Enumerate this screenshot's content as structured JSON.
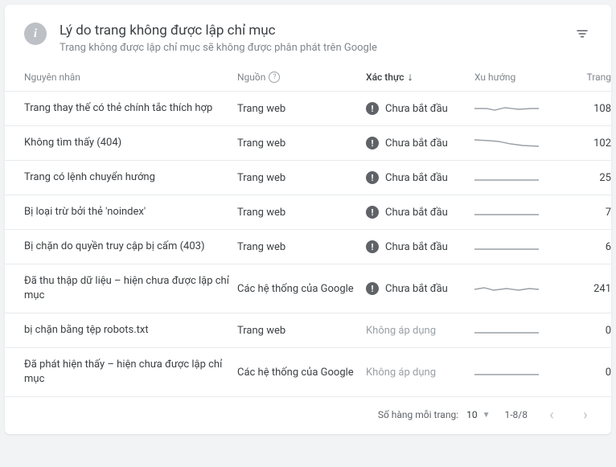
{
  "header": {
    "title": "Lý do trang không được lập chỉ mục",
    "subtitle": "Trang không được lập chỉ mục sẽ không được phân phát trên Google"
  },
  "columns": {
    "reason": "Nguyên nhân",
    "source": "Nguồn",
    "validation": "Xác thực",
    "trend": "Xu hướng",
    "pages": "Trang"
  },
  "status_labels": {
    "not_started": "Chưa bắt đầu",
    "na": "Không áp dụng"
  },
  "rows": [
    {
      "reason": "Trang thay thế có thẻ chính tắc thích hợp",
      "source": "Trang web",
      "status": "not_started",
      "trend": "wobble1",
      "pages": 108
    },
    {
      "reason": "Không tìm thấy (404)",
      "source": "Trang web",
      "status": "not_started",
      "trend": "down1",
      "pages": 102
    },
    {
      "reason": "Trang có lệnh chuyển hướng",
      "source": "Trang web",
      "status": "not_started",
      "trend": "flat",
      "pages": 25
    },
    {
      "reason": "Bị loại trừ bởi thẻ 'noindex'",
      "source": "Trang web",
      "status": "not_started",
      "trend": "flat",
      "pages": 7
    },
    {
      "reason": "Bị chặn do quyền truy cập bị cấm (403)",
      "source": "Trang web",
      "status": "not_started",
      "trend": "flat",
      "pages": 6
    },
    {
      "reason": "Đã thu thập dữ liệu – hiện chưa được lập chỉ mục",
      "source": "Các hệ thống của Google",
      "status": "not_started",
      "trend": "wobble2",
      "pages": 241
    },
    {
      "reason": "bị chặn bằng tệp robots.txt",
      "source": "Trang web",
      "status": "na",
      "trend": "flat",
      "pages": 0
    },
    {
      "reason": "Đã phát hiện thấy – hiện chưa được lập chỉ mục",
      "source": "Các hệ thống của Google",
      "status": "na",
      "trend": "flat",
      "pages": 0
    }
  ],
  "pagination": {
    "rows_per_page_label": "Số hàng mỗi trang:",
    "rows_per_page_value": "10",
    "range": "1-8/8"
  }
}
